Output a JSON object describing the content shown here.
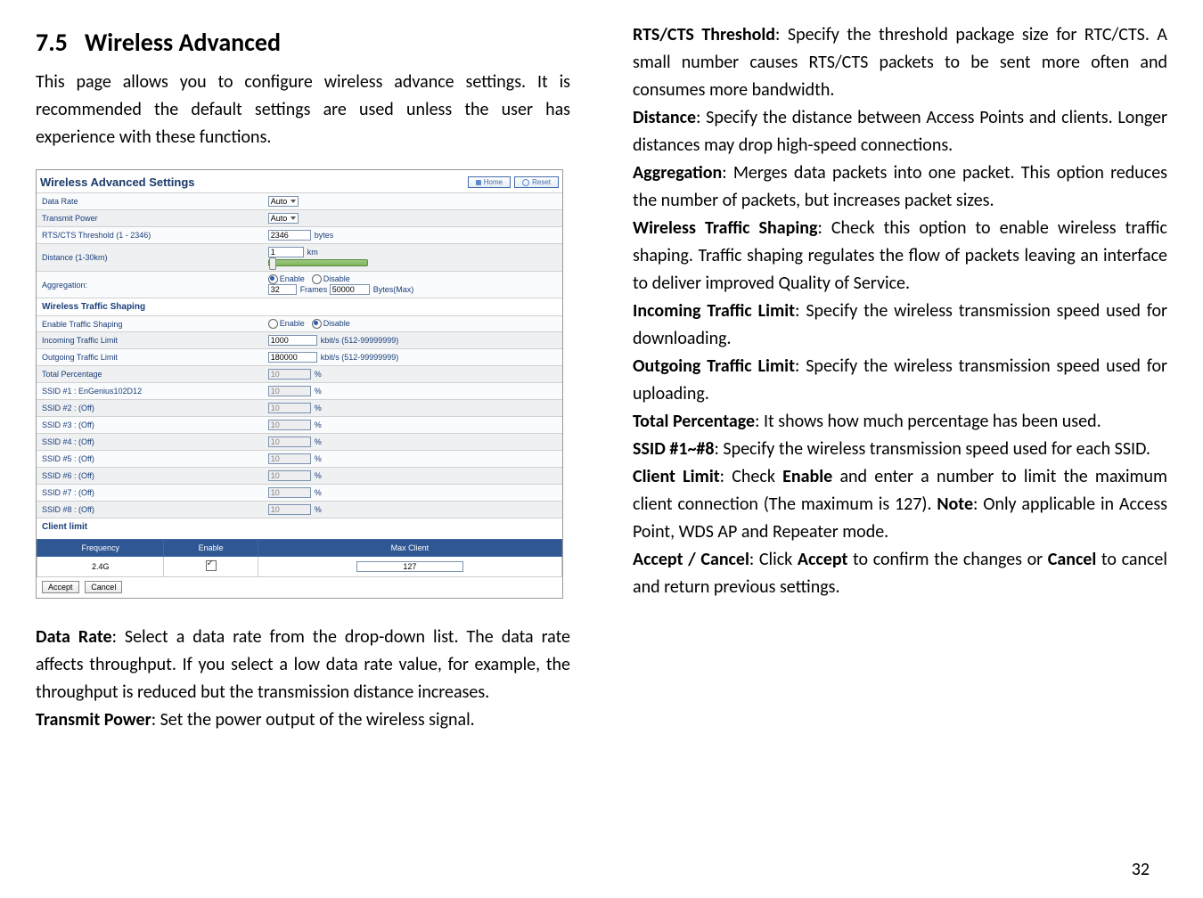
{
  "page_number": "32",
  "section": {
    "number": "7.5",
    "title": "Wireless Advanced",
    "intro": "This page allows you to configure wireless advance settings. It is recommended the default settings are used unless the user has experience with these functions."
  },
  "screenshot": {
    "title": "Wireless Advanced Settings",
    "home_btn": "Home",
    "reset_btn": "Reset",
    "rows": {
      "data_rate_lbl": "Data Rate",
      "data_rate_val": "Auto",
      "tx_power_lbl": "Transmit Power",
      "tx_power_val": "Auto",
      "rts_lbl": "RTS/CTS Threshold (1 - 2346)",
      "rts_val": "2346",
      "rts_unit": "bytes",
      "dist_lbl": "Distance (1-30km)",
      "dist_val": "1",
      "dist_unit": "km",
      "agg_lbl": "Aggregation:",
      "agg_enable": "Enable",
      "agg_disable": "Disable",
      "agg_frames_val": "32",
      "agg_frames_lbl": "Frames",
      "agg_bytes_val": "50000",
      "agg_bytes_lbl": "Bytes(Max)"
    },
    "traffic": {
      "section": "Wireless Traffic Shaping",
      "enable_lbl": "Enable Traffic Shaping",
      "enable": "Enable",
      "disable": "Disable",
      "incoming_lbl": "Incoming Traffic Limit",
      "incoming_val": "1000",
      "incoming_unit": "kbit/s (512-99999999)",
      "outgoing_lbl": "Outgoing Traffic Limit",
      "outgoing_val": "180000",
      "outgoing_unit": "kbit/s (512-99999999)",
      "total_lbl": "Total Percentage",
      "total_val": "10",
      "ssid1_lbl": "SSID #1 : EnGenius102D12",
      "ssid2_lbl": "SSID #2 : (Off)",
      "ssid3_lbl": "SSID #3 : (Off)",
      "ssid4_lbl": "SSID #4 : (Off)",
      "ssid5_lbl": "SSID #5 : (Off)",
      "ssid6_lbl": "SSID #6 : (Off)",
      "ssid7_lbl": "SSID #7 : (Off)",
      "ssid8_lbl": "SSID #8 : (Off)",
      "ssid_val": "10",
      "pct": "%"
    },
    "client": {
      "section": "Client limit",
      "h_freq": "Frequency",
      "h_enable": "Enable",
      "h_max": "Max Client",
      "freq": "2.4G",
      "max": "127"
    },
    "footer": {
      "accept": "Accept",
      "cancel": "Cancel"
    }
  },
  "desc": {
    "data_rate_t": "Data Rate",
    "data_rate": ": Select a data rate from the drop-down list. The data rate affects throughput. If you select a low data rate value, for example, the throughput is reduced but the transmission distance increases.",
    "tx_power_t": "Transmit Power",
    "tx_power": ": Set the power output of the wireless signal.",
    "rts_t": "RTS/CTS Threshold",
    "rts": ": Specify the threshold package size for RTC/CTS. A small number causes RTS/CTS packets to be sent more often and consumes more bandwidth.",
    "dist_t": "Distance",
    "dist": ": Specify the distance between Access Points and clients. Longer distances may drop high-speed connections.",
    "agg_t": "Aggregation",
    "agg": ": Merges data packets into one packet. This option reduces the number of packets, but increases packet sizes.",
    "wts_t": "Wireless Traffic Shaping",
    "wts": ": Check this option to enable wireless traffic shaping. Traffic shaping regulates the flow of packets leaving an interface to deliver improved Quality of Service.",
    "itl_t": "Incoming Traffic Limit",
    "itl": ": Specify the wireless transmission speed used for downloading.",
    "otl_t": "Outgoing Traffic Limit",
    "otl": ": Specify the wireless transmission speed used for uploading.",
    "tp_t": "Total Percentage",
    "tp": ": It shows how much percentage has been used.",
    "ssid_t": "SSID #1~#8",
    "ssid": ": Specify the wireless transmission speed used for each SSID.",
    "cl_t": "Client Limit",
    "cl_a": ": Check ",
    "cl_enable": "Enable",
    "cl_b": " and enter a number to limit the maximum client connection (The maximum is 127). ",
    "cl_note_t": "Note",
    "cl_note": ": Only applicable in Access Point, WDS AP and Repeater mode.",
    "ac_t": "Accept / Cancel",
    "ac_a": ": Click ",
    "ac_accept": "Accept",
    "ac_b": " to confirm the changes or ",
    "ac_cancel": "Cancel",
    "ac_c": " to cancel and return previous settings."
  }
}
